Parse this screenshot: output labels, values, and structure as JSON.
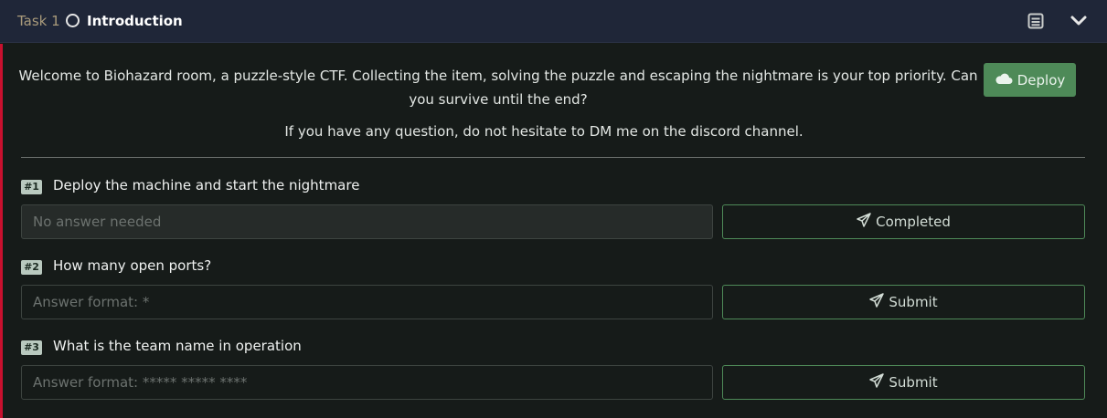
{
  "header": {
    "task_label": "Task 1",
    "title": "Introduction",
    "status_icon": "circle-outline-icon",
    "notes_icon": "notes-icon",
    "collapse_icon": "chevron-down-icon"
  },
  "intro": {
    "line1": "Welcome to Biohazard room, a puzzle-style CTF. Collecting the item, solving the puzzle and escaping the nightmare is your top priority. Can you survive until the end?",
    "line2": "If you have any question, do not hesitate to DM me on the discord channel."
  },
  "deploy": {
    "label": "Deploy",
    "icon": "cloud-icon"
  },
  "questions": [
    {
      "number": "#1",
      "text": "Deploy the machine and start the nightmare",
      "placeholder": "No answer needed",
      "button": "Completed",
      "button_icon": "paper-plane-icon",
      "disabled": true
    },
    {
      "number": "#2",
      "text": "How many open ports?",
      "placeholder": "Answer format: *",
      "button": "Submit",
      "button_icon": "paper-plane-icon",
      "disabled": false
    },
    {
      "number": "#3",
      "text": "What is the team name in operation",
      "placeholder": "Answer format: ***** ***** ****",
      "button": "Submit",
      "button_icon": "paper-plane-icon",
      "disabled": false
    }
  ],
  "colors": {
    "header_bg": "#1f2638",
    "body_bg": "#161b19",
    "accent_red": "#c8102e",
    "accent_green": "#4e8a58",
    "task_label": "#a99a7b"
  }
}
